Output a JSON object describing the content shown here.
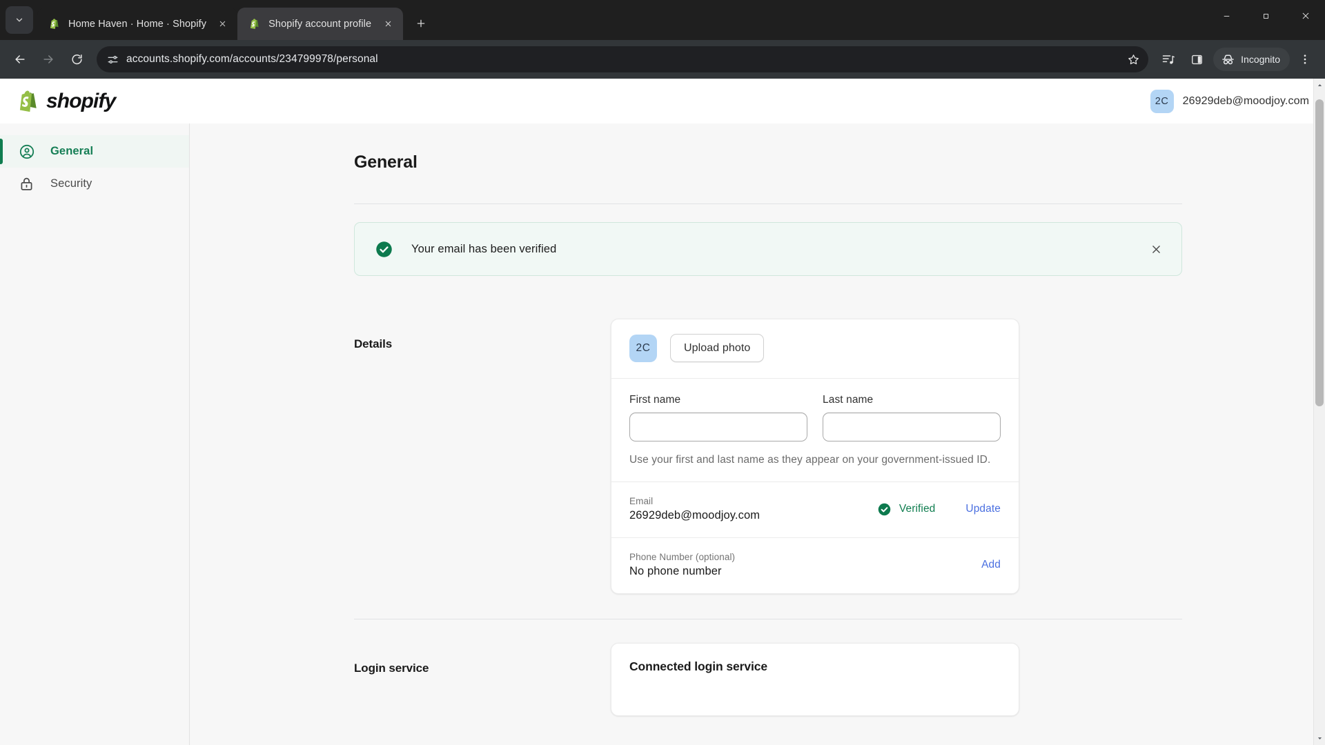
{
  "browser": {
    "tab_search_icon": "chevron-down-icon",
    "tabs": [
      {
        "title": "Home Haven · Home · Shopify",
        "favicon": "shopify-favicon",
        "active": false
      },
      {
        "title": "Shopify account profile",
        "favicon": "shopify-favicon",
        "active": true
      }
    ],
    "new_tab_label": "+",
    "window_controls": {
      "minimize": "minimize-icon",
      "maximize": "maximize-icon",
      "close": "close-icon"
    },
    "toolbar": {
      "back_icon": "back-arrow-icon",
      "forward_icon": "forward-arrow-icon",
      "reload_icon": "reload-icon",
      "site_info_icon": "site-settings-icon",
      "url": "accounts.shopify.com/accounts/234799978/personal",
      "bookmark_icon": "star-icon",
      "media_icon": "media-control-icon",
      "side_panel_icon": "side-panel-icon",
      "incognito_label": "Incognito",
      "incognito_icon": "incognito-icon",
      "menu_icon": "three-dot-menu-icon"
    }
  },
  "header": {
    "logo_text": "shopify",
    "logo_icon": "shopify-bag-icon",
    "avatar_initials": "2C",
    "account_email": "26929deb@moodjoy.com"
  },
  "sidebar": {
    "items": [
      {
        "label": "General",
        "icon": "account-circle-icon",
        "active": true
      },
      {
        "label": "Security",
        "icon": "lock-icon",
        "active": false
      }
    ]
  },
  "main": {
    "page_title": "General",
    "banner": {
      "message": "Your email has been verified",
      "icon": "check-circle-icon",
      "close_icon": "close-icon"
    },
    "details": {
      "section_label": "Details",
      "avatar_initials": "2C",
      "upload_photo_label": "Upload photo",
      "first_name": {
        "label": "First name",
        "value": "",
        "placeholder": ""
      },
      "last_name": {
        "label": "Last name",
        "value": "",
        "placeholder": ""
      },
      "name_helper": "Use your first and last name as they appear on your government-issued ID.",
      "email": {
        "label": "Email",
        "value": "26929deb@moodjoy.com",
        "status": "Verified",
        "status_icon": "check-circle-icon",
        "action": "Update"
      },
      "phone": {
        "label": "Phone Number (optional)",
        "value": "No phone number",
        "action": "Add"
      }
    },
    "login_service": {
      "section_label": "Login service",
      "card_title": "Connected login service"
    }
  },
  "colors": {
    "brand_green": "#0f7d4f",
    "link_blue": "#4a6fe0",
    "avatar_blue": "#b3d5f5",
    "banner_bg": "#f1f8f5",
    "page_bg": "#f7f7f7"
  }
}
